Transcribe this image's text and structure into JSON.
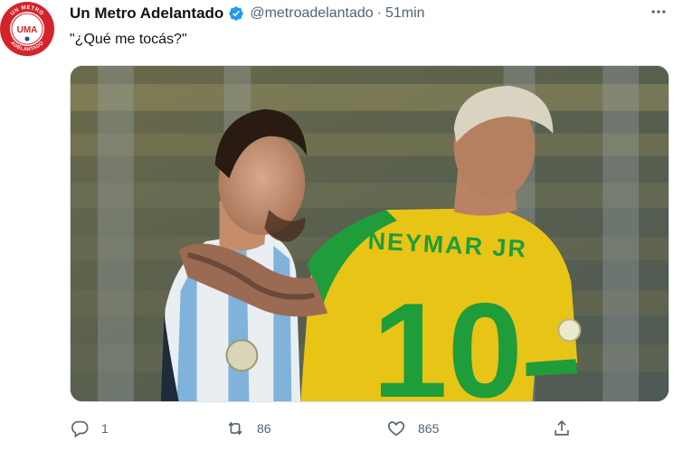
{
  "account": {
    "display_name": "Un Metro Adelantado",
    "handle": "@metroadelantado",
    "separator": "·",
    "time": "51min",
    "avatar_logo_text": "UMA",
    "avatar_ring_text_top": "UN METRO",
    "avatar_ring_text_bottom": "ADELANTADO",
    "verified": true,
    "avatar_color": "#d4242a",
    "verified_color": "#1d9bf0"
  },
  "tweet": {
    "text": "\"¿Qué me tocás?\""
  },
  "media": {
    "jersey_name": "NEYMAR JR",
    "jersey_number": "10"
  },
  "actions": {
    "reply": {
      "icon": "reply-icon",
      "count": "1"
    },
    "retweet": {
      "icon": "retweet-icon",
      "count": "86"
    },
    "like": {
      "icon": "heart-icon",
      "count": "865"
    },
    "share": {
      "icon": "share-icon"
    }
  },
  "colors": {
    "text": "#0f1419",
    "secondary": "#536471",
    "brasil_yellow": "#e8c417",
    "brasil_green": "#1f9d3a"
  }
}
